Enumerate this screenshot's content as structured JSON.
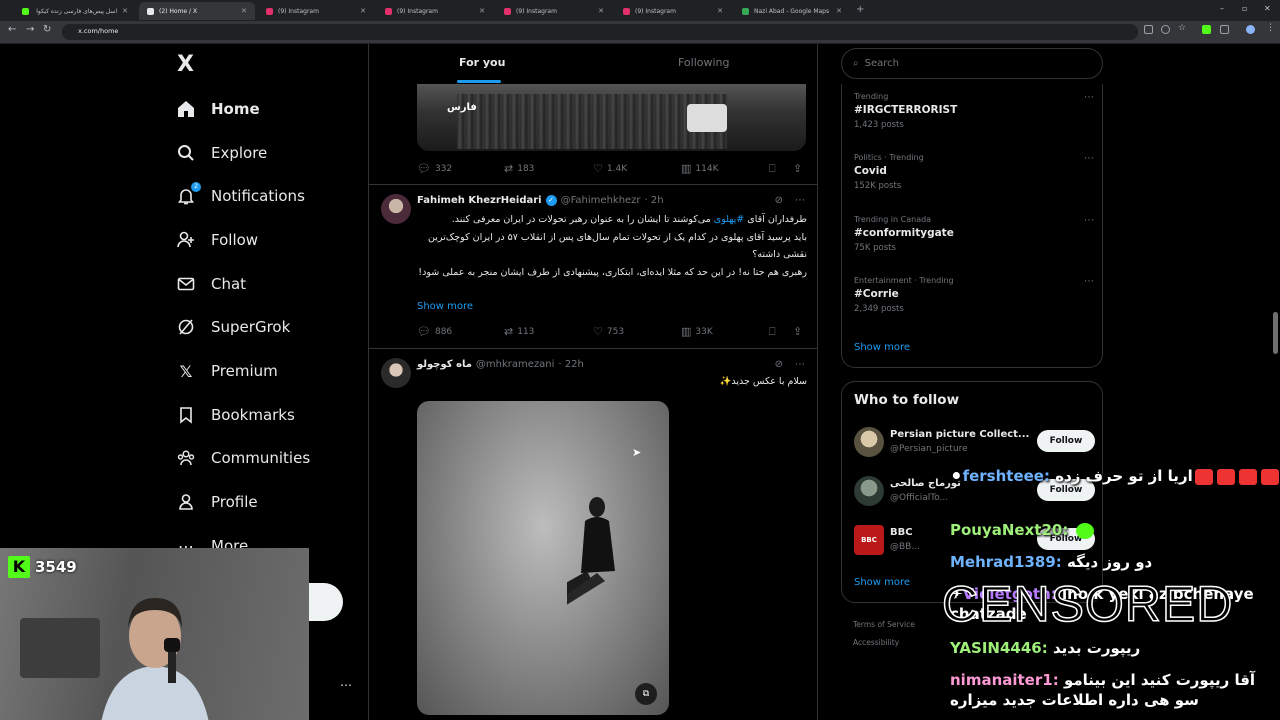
{
  "browser": {
    "tabs": [
      {
        "title": "اسل پیس‌های فارسی زنده کیکوآ و ...",
        "color": "#53fc18"
      },
      {
        "title": "(2) Home / X",
        "color": "#e7e9ea"
      },
      {
        "title": "(9) Instagram",
        "color": "#e1306c"
      },
      {
        "title": "(9) Instagram",
        "color": "#e1306c"
      },
      {
        "title": "(9) Instagram",
        "color": "#e1306c"
      },
      {
        "title": "(9) Instagram",
        "color": "#e1306c"
      },
      {
        "title": "Nazi Abad - Google Maps",
        "color": "#34a853"
      }
    ],
    "url": "x.com/home"
  },
  "sidebar": {
    "logo": "X",
    "items": [
      {
        "label": "Home",
        "icon": "home-icon"
      },
      {
        "label": "Explore",
        "icon": "search-icon"
      },
      {
        "label": "Notifications",
        "icon": "bell-icon",
        "badge": "2"
      },
      {
        "label": "Follow",
        "icon": "person-add-icon"
      },
      {
        "label": "Chat",
        "icon": "mail-icon"
      },
      {
        "label": "SuperGrok",
        "icon": "grok-icon"
      },
      {
        "label": "Premium",
        "icon": "x-icon"
      },
      {
        "label": "Bookmarks",
        "icon": "bookmark-icon"
      },
      {
        "label": "Communities",
        "icon": "people-icon"
      },
      {
        "label": "Profile",
        "icon": "person-icon"
      },
      {
        "label": "More",
        "icon": "more-icon"
      }
    ]
  },
  "feed": {
    "tabs": {
      "for_you": "For you",
      "following": "Following"
    },
    "post1": {
      "image_watermark": "فارس",
      "replies": "332",
      "reposts": "183",
      "likes": "1.4K",
      "views": "114K"
    },
    "post2": {
      "name": "Fahimeh KhezrHeidari",
      "handle": "@Fahimehkhezr",
      "time": "· 2h",
      "text1_pre": "طرفداران آقای ",
      "hashtag": "#پهلوی",
      "text1_post": " می‌کوشند تا ایشان را به عنوان رهبر تحولات در ایران معرفی کنند.",
      "text2": "باید پرسید آقای پهلوی در کدام یک از تحولات تمام سال‌های پس از انقلاب ۵۷ در ایران کوچک‌ترین نقشی داشته؟",
      "text3": "رهبری هم حتا نه! در این حد که مثلا ایده‌ای، ابتکاری، پیشنهادی از طرف ایشان منجر به عملی شود!",
      "show_more": "Show more",
      "replies": "886",
      "reposts": "113",
      "likes": "753",
      "views": "33K"
    },
    "post3": {
      "name": "ماه کوچولو",
      "handle": "@mhkramezani",
      "time": "· 22h",
      "text": "سلام با عکس جدید✨"
    }
  },
  "right": {
    "search_placeholder": "Search",
    "trends": [
      {
        "context": "Trending",
        "title": "#IRGCTERRORIST",
        "count": "1,423 posts"
      },
      {
        "context": "Politics · Trending",
        "title": "Covid",
        "count": "152K posts"
      },
      {
        "context": "Trending in Canada",
        "title": "#conformitygate",
        "count": "75K posts"
      },
      {
        "context": "Entertainment · Trending",
        "title": "#Corrie",
        "count": "2,349 posts"
      }
    ],
    "trends_show_more": "Show more",
    "who_to_follow": {
      "title": "Who to follow",
      "accounts": [
        {
          "name": "Persian picture Collect...",
          "handle": "@Persian_picture",
          "button": "Follow"
        },
        {
          "name": "تورماج صالحی",
          "handle": "@OfficialTo...",
          "button": "Follow"
        },
        {
          "name": "BBC",
          "handle": "@BB...",
          "button": "Follow"
        }
      ],
      "show_more": "Show more"
    },
    "footer": {
      "terms": "Terms of Service",
      "accessibility": "Accessibility"
    }
  },
  "stream": {
    "viewers": "3549",
    "chat": [
      {
        "user": "fershteee:",
        "msg": "اریا از تو حرف زده"
      },
      {
        "user": "PouyaNext20:",
        "msg": ""
      },
      {
        "user": "Mehrad1389:",
        "msg": "دو روز دیگه"
      },
      {
        "user": "Violetgoth:",
        "msg": "ino k yeki az bchehaye chatzade"
      },
      {
        "user": "YASIN4446:",
        "msg": "ریپورت بدید"
      },
      {
        "user": "nimanaiter1:",
        "msg": "آقا ریپورت کنید این بینامو سو هی داره اطلاعات جدید میزاره"
      }
    ],
    "censored": "CENSORED"
  }
}
